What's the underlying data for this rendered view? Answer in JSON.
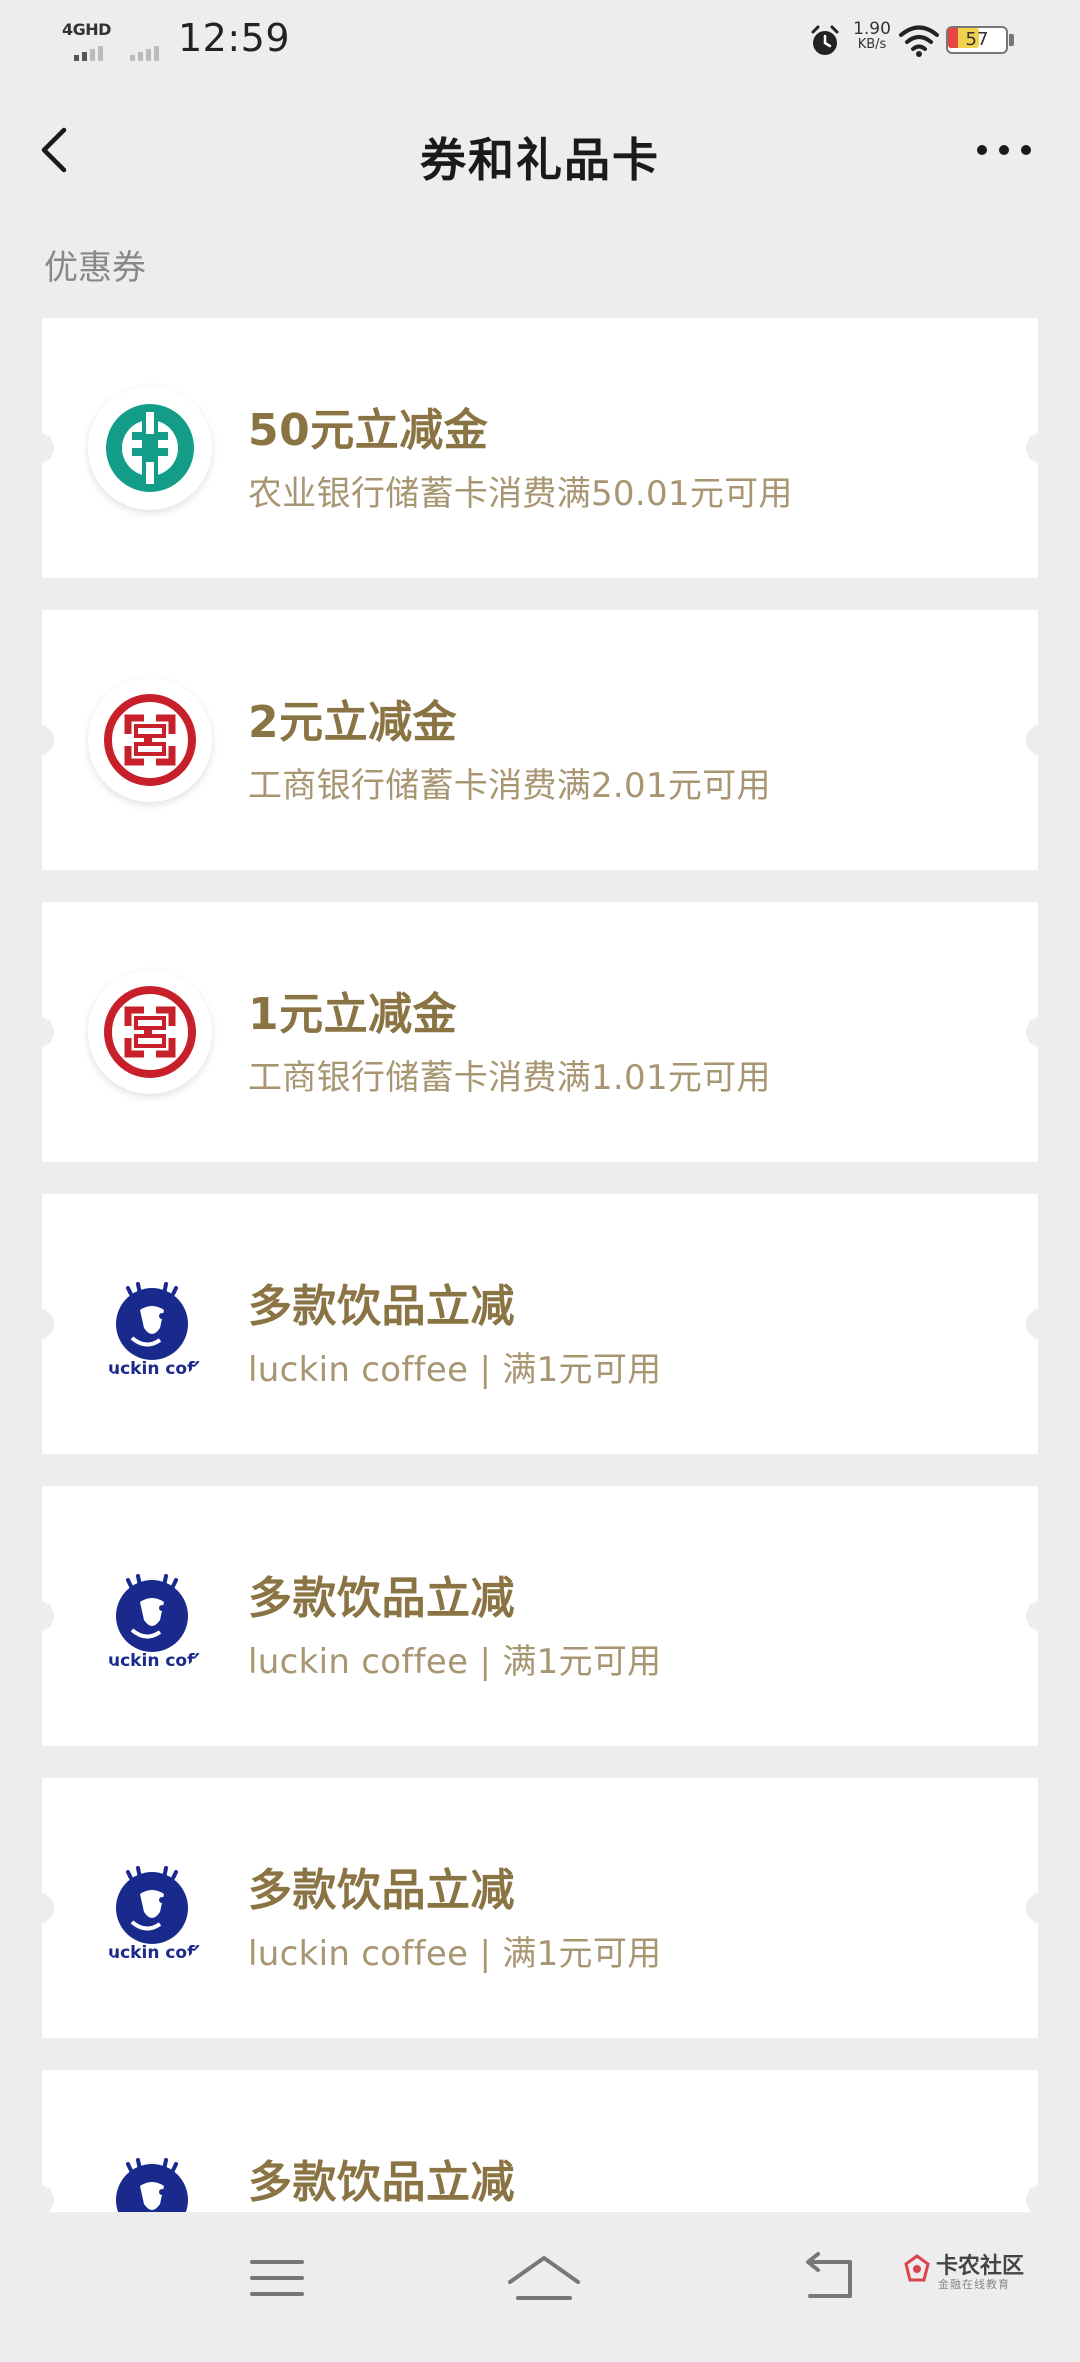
{
  "status_bar": {
    "network_label": "4GHD",
    "time": "12:59",
    "speed_value": "1.90",
    "speed_unit": "KB/s",
    "battery_level": "57",
    "battery_fraction": 0.57
  },
  "header": {
    "title": "券和礼品卡"
  },
  "section": {
    "label": "优惠券"
  },
  "colors": {
    "abc_green": "#139d88",
    "icbc_red": "#c8202a",
    "luckin_blue": "#1a2a8c",
    "coupon_title": "#8a7443",
    "coupon_desc": "#a89571"
  },
  "coupons": [
    {
      "logo": "abc-logo-icon",
      "title": "50元立减金",
      "desc": "农业银行储蓄卡消费满50.01元可用"
    },
    {
      "logo": "icbc-logo-icon",
      "title": "2元立减金",
      "desc": "工商银行储蓄卡消费满2.01元可用"
    },
    {
      "logo": "icbc-logo-icon",
      "title": "1元立减金",
      "desc": "工商银行储蓄卡消费满1.01元可用"
    },
    {
      "logo": "luckin-logo-icon",
      "title": "多款饮品立减",
      "desc": "luckin coffee | 满1元可用"
    },
    {
      "logo": "luckin-logo-icon",
      "title": "多款饮品立减",
      "desc": "luckin coffee | 满1元可用"
    },
    {
      "logo": "luckin-logo-icon",
      "title": "多款饮品立减",
      "desc": "luckin coffee | 满1元可用"
    },
    {
      "logo": "luckin-logo-icon",
      "title": "多款饮品立减",
      "desc": ""
    }
  ],
  "watermark": {
    "title": "卡农社区",
    "subtitle": "金融在线教育"
  }
}
